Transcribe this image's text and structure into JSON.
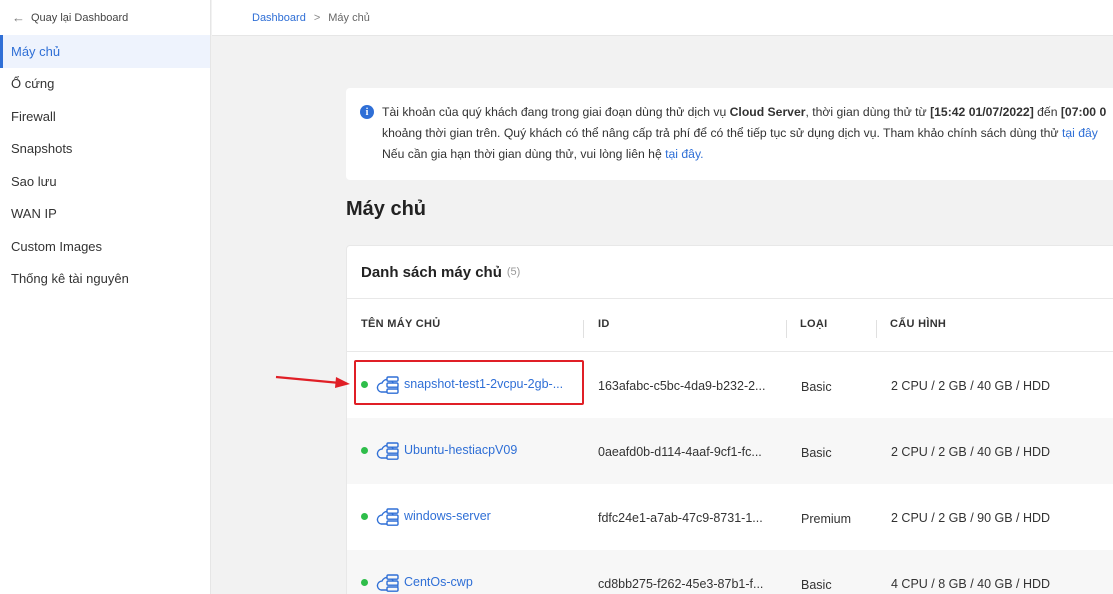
{
  "sidebar": {
    "back_label": "Quay lại Dashboard",
    "items": [
      {
        "label": "Máy chủ",
        "active": true
      },
      {
        "label": "Ổ cứng"
      },
      {
        "label": "Firewall"
      },
      {
        "label": "Snapshots"
      },
      {
        "label": "Sao lưu"
      },
      {
        "label": "WAN IP"
      },
      {
        "label": "Custom Images"
      },
      {
        "label": "Thống kê tài nguyên"
      }
    ]
  },
  "breadcrumb": {
    "root": "Dashboard",
    "separator": ">",
    "current": "Máy chủ"
  },
  "notice": {
    "line1_a": "Tài khoản của quý khách đang trong giai đoạn dùng thử dịch vụ ",
    "line1_service": "Cloud Server",
    "line1_b": ", thời gian dùng thử từ ",
    "line1_start": "[15:42 01/07/2022]",
    "line1_c": " đến ",
    "line1_end": "[07:00 0",
    "line2_a": "khoảng thời gian trên. Quý khách có thể nâng cấp trả phí để có thể tiếp tục sử dụng dịch vụ. Tham khảo chính sách dùng thử ",
    "line2_link": "tại đây",
    "line3_a": "Nếu cần gia hạn thời gian dùng thử, vui lòng liên hệ ",
    "line3_link": "tại đây."
  },
  "page": {
    "title": "Máy chủ"
  },
  "server_list": {
    "title": "Danh sách máy chủ",
    "count": "(5)",
    "columns": [
      "TÊN MÁY CHỦ",
      "ID",
      "LOẠI",
      "CẤU HÌNH"
    ],
    "rows": [
      {
        "name": "snapshot-test1-2vcpu-2gb-...",
        "id": "163afabc-c5bc-4da9-b232-2...",
        "type": "Basic",
        "config": "2 CPU / 2 GB / 40 GB / HDD",
        "status_color": "#2ebd4a"
      },
      {
        "name": "Ubuntu-hestiacpV09",
        "id": "0aeafd0b-d114-4aaf-9cf1-fc...",
        "type": "Basic",
        "config": "2 CPU / 2 GB / 40 GB / HDD",
        "status_color": "#2ebd4a"
      },
      {
        "name": "windows-server",
        "id": "fdfc24e1-a7ab-47c9-8731-1...",
        "type": "Premium",
        "config": "2 CPU / 2 GB / 90 GB / HDD",
        "status_color": "#2ebd4a"
      },
      {
        "name": "CentOs-cwp",
        "id": "cd8bb275-f262-45e3-87b1-f...",
        "type": "Basic",
        "config": "4 CPU / 8 GB / 40 GB / HDD",
        "status_color": "#2ebd4a"
      }
    ]
  },
  "colors": {
    "accent": "#2f6fd6",
    "status_online": "#2ebd4a",
    "annotation_red": "#e01f26"
  }
}
